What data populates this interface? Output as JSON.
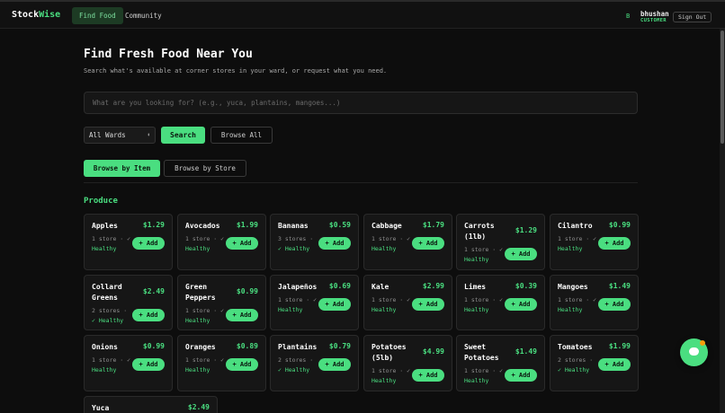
{
  "header": {
    "logo_main": "Stock",
    "logo_accent": "Wise",
    "nav": [
      {
        "label": "Find Food",
        "active": true
      },
      {
        "label": "Community",
        "active": false
      }
    ],
    "user_initial": "B",
    "user_name": "bhushan",
    "user_role": "CUSTOMER",
    "sign_out": "Sign Out"
  },
  "main": {
    "title": "Find Fresh Food Near You",
    "subtitle": "Search what's available at corner stores in your ward, or request what you need.",
    "search_placeholder": "What are you looking for? (e.g., yuca, plantains, mangoes...)",
    "ward_select": "All Wards",
    "search_button": "Search",
    "browse_all": "Browse All",
    "tabs": [
      "Browse by Item",
      "Browse by Store"
    ],
    "section": "Produce",
    "add_label": "+ Add",
    "items": [
      {
        "name": "Apples",
        "price": "$1.29",
        "stores": "1 store · ✓",
        "health": "Healthy"
      },
      {
        "name": "Avocados",
        "price": "$1.99",
        "stores": "1 store · ✓",
        "health": "Healthy"
      },
      {
        "name": "Bananas",
        "price": "$0.59",
        "stores": "3 stores ·",
        "health": "✓ Healthy"
      },
      {
        "name": "Cabbage",
        "price": "$1.79",
        "stores": "1 store · ✓",
        "health": "Healthy"
      },
      {
        "name": "Carrots (1lb)",
        "price": "$1.29",
        "stores": "1 store · ✓",
        "health": "Healthy"
      },
      {
        "name": "Cilantro",
        "price": "$0.99",
        "stores": "1 store · ✓",
        "health": "Healthy"
      },
      {
        "name": "Collard Greens",
        "price": "$2.49",
        "stores": "2 stores ·",
        "health": "✓ Healthy"
      },
      {
        "name": "Green Peppers",
        "price": "$0.99",
        "stores": "1 store · ✓",
        "health": "Healthy"
      },
      {
        "name": "Jalapeños",
        "price": "$0.69",
        "stores": "1 store · ✓",
        "health": "Healthy"
      },
      {
        "name": "Kale",
        "price": "$2.99",
        "stores": "1 store · ✓",
        "health": "Healthy"
      },
      {
        "name": "Limes",
        "price": "$0.39",
        "stores": "1 store · ✓",
        "health": "Healthy"
      },
      {
        "name": "Mangoes",
        "price": "$1.49",
        "stores": "1 store · ✓",
        "health": "Healthy"
      },
      {
        "name": "Onions",
        "price": "$0.99",
        "stores": "1 store · ✓",
        "health": "Healthy"
      },
      {
        "name": "Oranges",
        "price": "$0.89",
        "stores": "1 store · ✓",
        "health": "Healthy"
      },
      {
        "name": "Plantains",
        "price": "$0.79",
        "stores": "2 stores ·",
        "health": "✓ Healthy"
      },
      {
        "name": "Potatoes (5lb)",
        "price": "$4.99",
        "stores": "1 store · ✓",
        "health": "Healthy"
      },
      {
        "name": "Sweet Potatoes",
        "price": "$1.49",
        "stores": "1 store · ✓",
        "health": "Healthy"
      },
      {
        "name": "Tomatoes",
        "price": "$1.99",
        "stores": "2 stores ·",
        "health": "✓ Healthy"
      },
      {
        "name": "Yuca",
        "price": "$2.49",
        "stores": "",
        "health": ""
      }
    ]
  }
}
